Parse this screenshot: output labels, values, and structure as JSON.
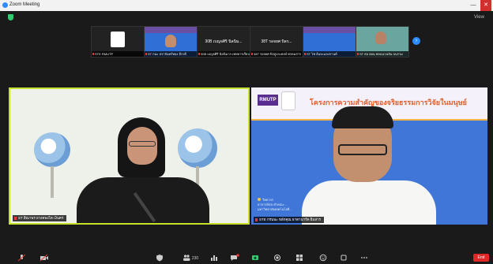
{
  "window": {
    "title": "Zoom Meeting",
    "minimize_label": "—",
    "close_label": "✕"
  },
  "header": {
    "view_label": "View"
  },
  "thumbnails": [
    {
      "name": "",
      "caption": "STE RMUTP"
    },
    {
      "name": "",
      "caption": "ST กนะ ปราจันทร์ทอง อีรวดี"
    },
    {
      "name": "30B เบญจศิริ นิลนิม...",
      "caption": "30B เบญจศิริ นิลนิมาก  เทพธารเรียบเ"
    },
    {
      "name": "38T รอจยศ บิลร...",
      "caption": "38T รอจยศ บิลสูงละพงษ์  พรหมสาร"
    },
    {
      "name": "",
      "caption": "ST ไฟ อ้นจะแลงกานต์"
    },
    {
      "name": "",
      "caption": "ST ธ่อ อ่อน พลฉนวนจัน บนรวม"
    }
  ],
  "main": {
    "left_caption": "ST สิณาพร ยางคพงโต เงินคร",
    "right_caption": "STE กรนนะ หลักคุณ ธาดานาร์ด ยิมสาร",
    "slide": {
      "brand": "RMUTP",
      "title": "โครงการความสำคัญของจริยธรรมการวิจัยในมนุษย์",
      "footnote_head": "วิทยากร",
      "footnote_lines": [
        "อาจารย์ประจำคณะ...",
        "มหาวิทยาลัยเทคโนโลยี..."
      ]
    }
  },
  "toolbar": {
    "participants_count": "230",
    "end_label": "End"
  },
  "colors": {
    "accent": "#2d8cff",
    "active_speaker": "#c6e02c",
    "end": "#e02828"
  }
}
